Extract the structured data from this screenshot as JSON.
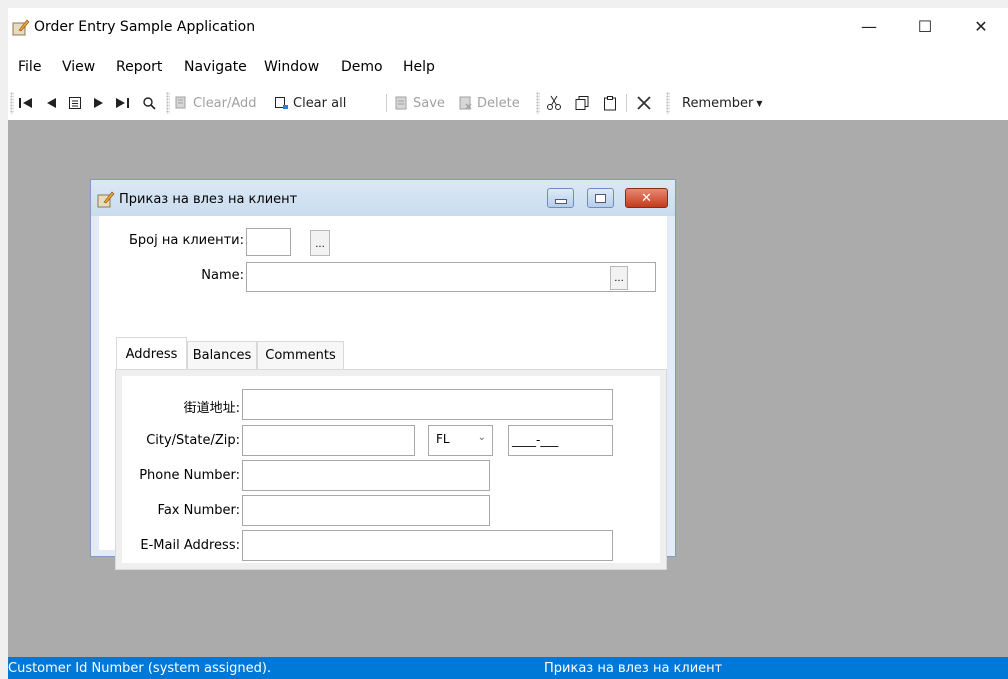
{
  "window": {
    "title": "Order Entry Sample Application"
  },
  "menu": [
    "File",
    "View",
    "Report",
    "Navigate",
    "Window",
    "Demo",
    "Help"
  ],
  "toolbar": {
    "clear_add": "Clear/Add",
    "clear_all": "Clear all",
    "save": "Save",
    "delete": "Delete",
    "remember": "Remember"
  },
  "child": {
    "title": "Приказ на влез на клиент",
    "customer_number_label": "Број на клиенти:",
    "name_label": "Name:",
    "tabs": [
      "Address",
      "Balances",
      "Comments"
    ],
    "street_label": "街道地址:",
    "city_label": "City/State/Zip:",
    "state_value": "FL",
    "zip_mask": "____-___",
    "phone_label": "Phone Number:",
    "fax_label": "Fax Number:",
    "email_label": "E-Mail Address:"
  },
  "status": {
    "left": "Customer Id Number (system assigned).",
    "right": "Приказ на влез на клиент"
  }
}
